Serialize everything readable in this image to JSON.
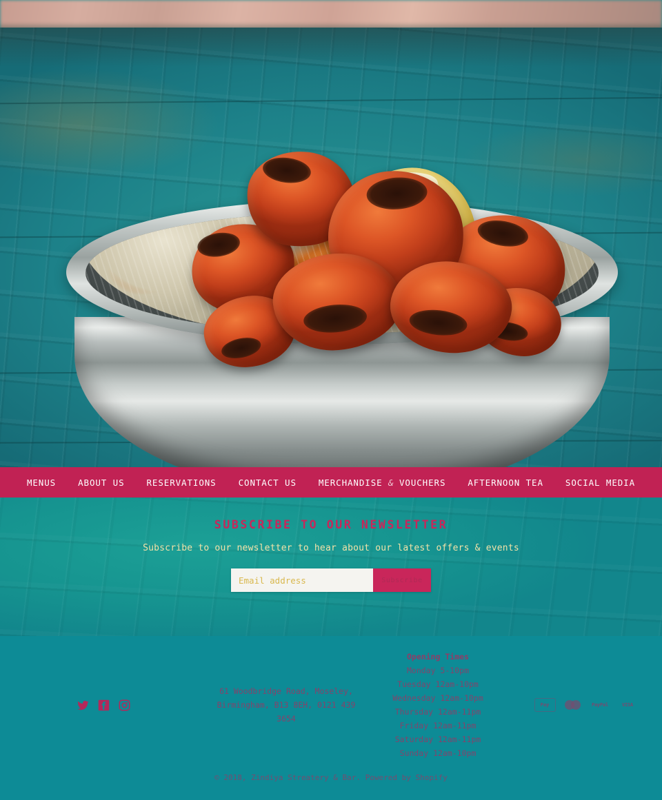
{
  "hero": {
    "alt": "Tandoori chicken tikka pieces with slaw and a lemon wedge in a steel bowl on a teal painted wooden table"
  },
  "nav": {
    "items": [
      {
        "label": "MENUS",
        "name": "nav-item-menus"
      },
      {
        "label": "ABOUT US",
        "name": "nav-item-about-us"
      },
      {
        "label": "RESERVATIONS",
        "name": "nav-item-reservations"
      },
      {
        "label": "CONTACT US",
        "name": "nav-item-contact-us"
      },
      {
        "label": "MERCHANDISE",
        "amp": "&",
        "label2": "VOUCHERS",
        "name": "nav-item-merchandise-vouchers"
      },
      {
        "label": "AFTERNOON TEA",
        "name": "nav-item-afternoon-tea"
      },
      {
        "label": "SOCIAL MEDIA",
        "name": "nav-item-social-media"
      }
    ],
    "background_color": "#c12254",
    "text_color": "#ffffff"
  },
  "newsletter": {
    "title": "SUBSCRIBE TO OUR NEWSLETTER",
    "subtitle": "Subscribe to our newsletter to hear about our latest offers & events",
    "email_placeholder": "Email address",
    "email_value": "",
    "subscribe_label": "Subscribe",
    "background_color": "#17998f",
    "title_color": "#c9265a",
    "subtitle_color": "#f2e2a8"
  },
  "footer": {
    "social": [
      {
        "name": "twitter-icon",
        "label": "Twitter"
      },
      {
        "name": "facebook-icon",
        "label": "Facebook"
      },
      {
        "name": "instagram-icon",
        "label": "Instagram"
      }
    ],
    "address": "61 Woodbridge Road, Moseley, Birmingham, B13 8EH, 0121 439 3654",
    "hours_title": "Opening Times",
    "hours": [
      "Monday 5-10pm",
      "Tuesday 12am-10pm",
      "Wednesday 12am-10pm",
      "Thursday 12am-11pm",
      "Friday 12am-11pm",
      "Saturday 12am-11pm",
      "Sunday 12am-10pm"
    ],
    "payments": [
      {
        "name": "apple-pay-icon",
        "label": "Pay"
      },
      {
        "name": "mastercard-icon",
        "label": ""
      },
      {
        "name": "paypal-icon",
        "label": "PayPal"
      },
      {
        "name": "visa-icon",
        "label": "VISA"
      }
    ],
    "copyright": "© 2018, Zindiya Streatery & Bar. Powered by Shopify",
    "background_color": "#0d8b96",
    "text_color": "#b3285a"
  }
}
